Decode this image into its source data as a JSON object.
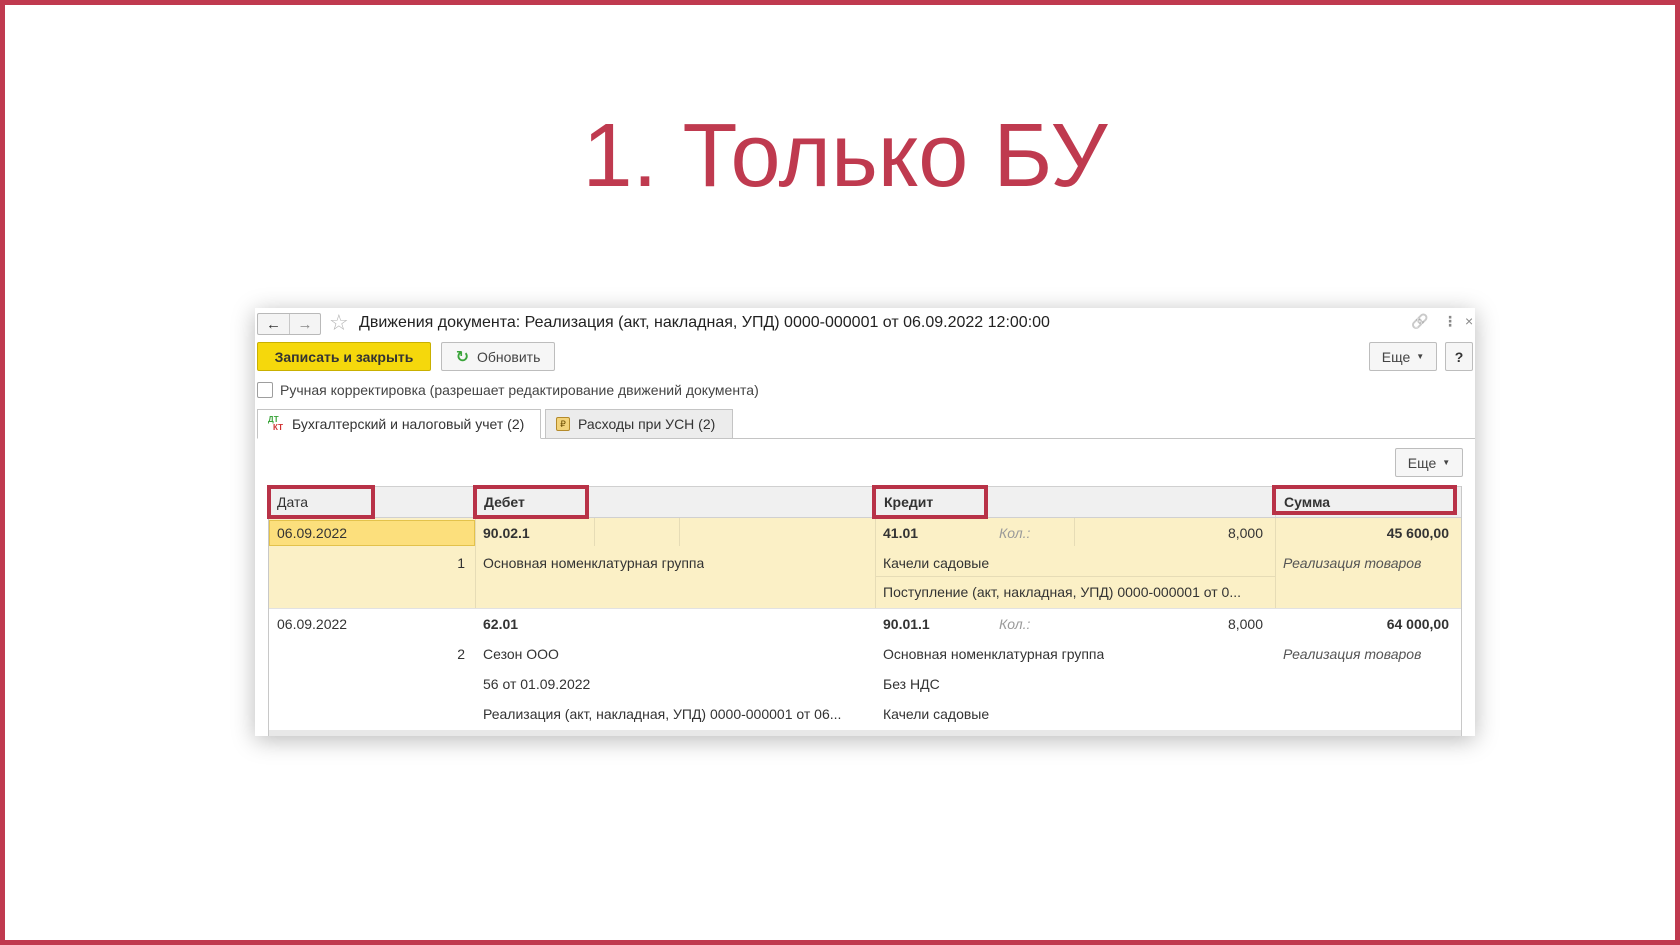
{
  "slide": {
    "title": "1. Только БУ",
    "accent_color": "#bf3a4f"
  },
  "window": {
    "title": "Движения документа: Реализация (акт, накладная, УПД) 0000-000001 от 06.09.2022 12:00:00",
    "nav_back_icon": "←",
    "nav_forward_icon": "→",
    "favorite_icon": "☆",
    "link_icon": "🔗",
    "menu_icon": "⋮",
    "close_icon": "×"
  },
  "toolbar": {
    "save_close_label": "Записать и закрыть",
    "refresh_label": "Обновить",
    "refresh_icon": "↻",
    "more_label": "Еще",
    "more_caret": "▼",
    "help_label": "?"
  },
  "manual_edit": {
    "label": "Ручная корректировка (разрешает редактирование движений документа)",
    "checked": false
  },
  "tabs": [
    {
      "label": "Бухгалтерский и налоговый учет (2)",
      "icon_top": "ДТ",
      "icon_bottom": "КТ",
      "active": true
    },
    {
      "label": "Расходы при УСН (2)",
      "icon": "₽",
      "active": false
    }
  ],
  "grid": {
    "more_label": "Еще",
    "more_caret": "▼",
    "columns": {
      "date": "Дата",
      "debit": "Дебет",
      "credit": "Кредит",
      "sum": "Сумма"
    },
    "rows": [
      {
        "date": "06.09.2022",
        "number": "1",
        "debit_account": "90.02.1",
        "debit_sub": [
          "Основная номенклатурная группа"
        ],
        "credit_account": "41.01",
        "qty_label": "Кол.:",
        "qty": "8,000",
        "credit_sub": [
          "Качели садовые",
          "Поступление (акт, накладная, УПД) 0000-000001 от 0..."
        ],
        "sum": "45 600,00",
        "content": "Реализация товаров"
      },
      {
        "date": "06.09.2022",
        "number": "2",
        "debit_account": "62.01",
        "debit_sub": [
          "Сезон ООО",
          "56 от 01.09.2022",
          "Реализация (акт, накладная, УПД) 0000-000001 от 06..."
        ],
        "credit_account": "90.01.1",
        "qty_label": "Кол.:",
        "qty": "8,000",
        "credit_sub": [
          "Основная номенклатурная группа",
          "Без НДС",
          "Качели садовые"
        ],
        "sum": "64 000,00",
        "content": "Реализация товаров"
      }
    ]
  }
}
